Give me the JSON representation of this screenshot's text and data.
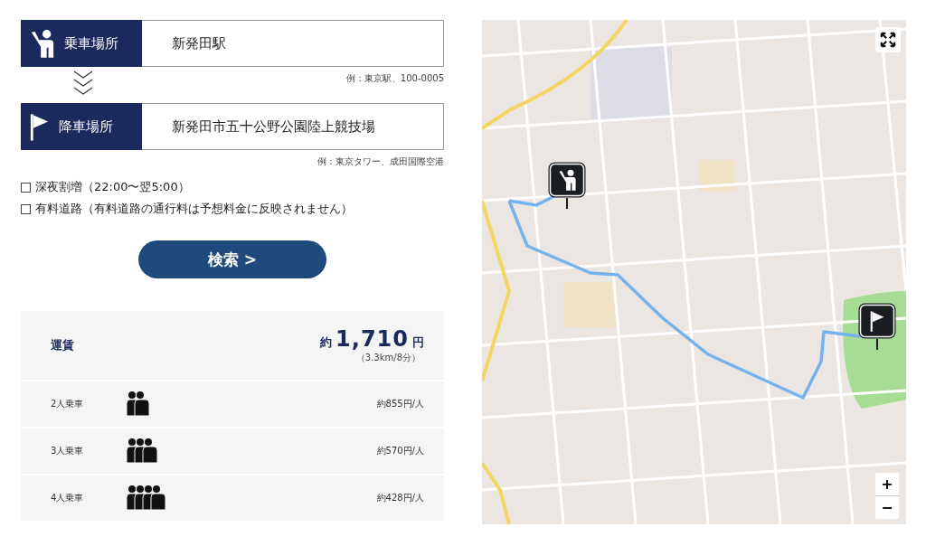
{
  "pickup": {
    "label": "乗車場所",
    "value": "新発田駅",
    "hint": "例：東京駅、100-0005"
  },
  "dropoff": {
    "label": "降車場所",
    "value": "新発田市五十公野公園陸上競技場",
    "hint": "例：東京タワー、成田国際空港"
  },
  "options": [
    {
      "label": "深夜割増（22:00〜翌5:00）",
      "checked": false
    },
    {
      "label": "有料道路（有料道路の通行料は予想料金に反映されません）",
      "checked": false
    }
  ],
  "search_button": "検索 >",
  "fare": {
    "label": "運賃",
    "prefix": "約",
    "amount": "1,710",
    "unit": "円",
    "detail": "（3.3km/8分）"
  },
  "split_rows": [
    {
      "label": "2人乗車",
      "kind": "pair",
      "price": "約855円/人"
    },
    {
      "label": "3人乗車",
      "kind": "trio",
      "price": "約570円/人"
    },
    {
      "label": "4人乗車",
      "kind": "quartet",
      "price": "約428円/人"
    }
  ],
  "map": {
    "kind": "picture",
    "zoom_in": "+",
    "zoom_out": "−"
  }
}
